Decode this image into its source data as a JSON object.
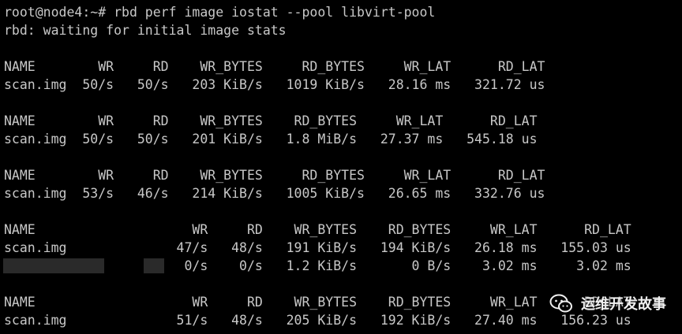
{
  "colors": {
    "background": "#000000",
    "text": "#c8c8c8",
    "redaction": "#2a2a2a"
  },
  "terminal": {
    "lines": [
      "root@node4:~# rbd perf image iostat --pool libvirt-pool",
      "rbd: waiting for initial image stats",
      "",
      "NAME        WR     RD    WR_BYTES     RD_BYTES     WR_LAT      RD_LAT",
      "scan.img  50/s   50/s   203 KiB/s   1019 KiB/s   28.16 ms   321.72 us",
      "",
      "NAME        WR     RD    WR_BYTES    RD_BYTES     WR_LAT      RD_LAT",
      "scan.img  50/s   50/s   201 KiB/s   1.8 MiB/s   27.37 ms   545.18 us",
      "",
      "NAME        WR     RD    WR_BYTES     RD_BYTES     WR_LAT      RD_LAT",
      "scan.img  53/s   46/s   214 KiB/s   1005 KiB/s   26.65 ms   332.76 us",
      "",
      "NAME                    WR     RD    WR_BYTES    RD_BYTES     WR_LAT      RD_LAT",
      "scan.img              47/s   48/s   191 KiB/s   194 KiB/s   26.18 ms   155.03 us",
      "                       0/s    0/s   1.2 KiB/s       0 B/s    3.02 ms     3.02 ms",
      "",
      "NAME                    WR     RD    WR_BYTES    RD_BYTES     WR_LAT      RD_LAT",
      "scan.img              51/s   48/s   205 KiB/s   192 KiB/s   27.40 ms   156.23 us"
    ]
  },
  "watermark": {
    "icon": "wechat-icon",
    "text": "运维开发故事"
  }
}
